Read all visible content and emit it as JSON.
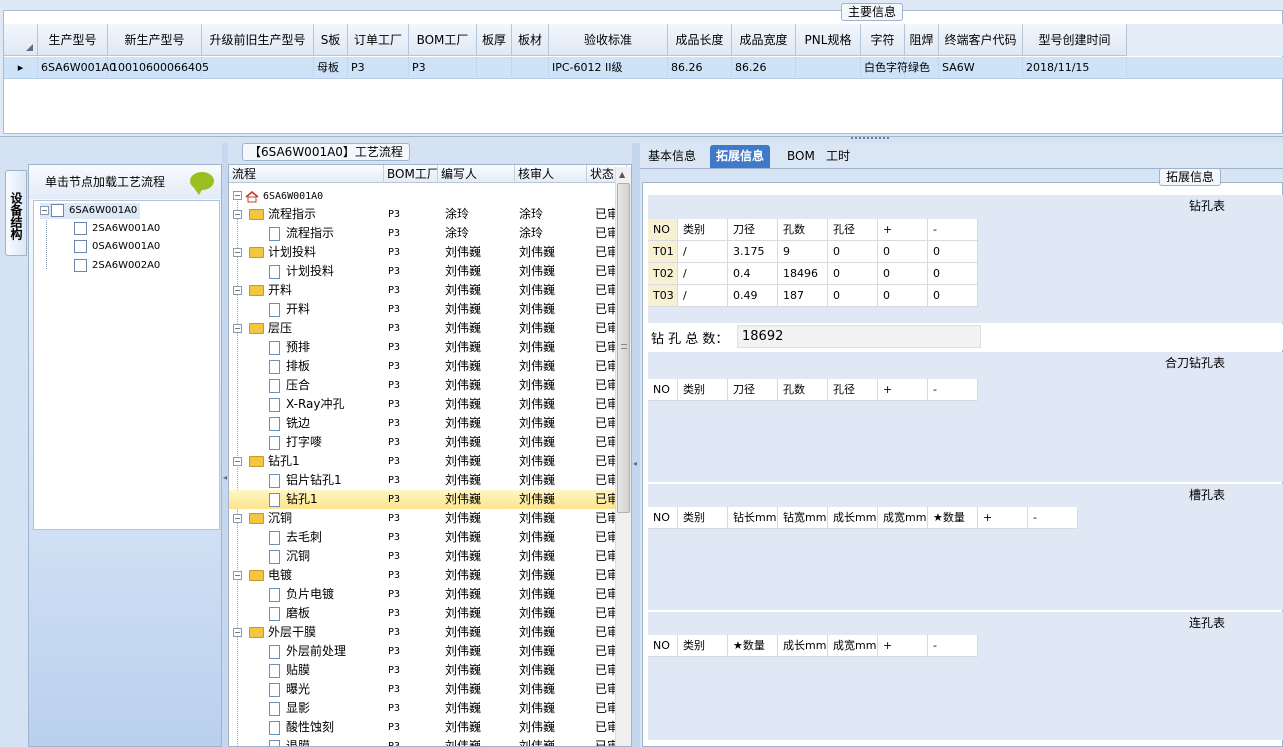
{
  "main_info": {
    "title": "主要信息",
    "columns": [
      "生产型号",
      "新生产型号",
      "升级前旧生产型号",
      "S板",
      "订单工厂",
      "BOM工厂",
      "板厚",
      "板材",
      "验收标准",
      "成品长度",
      "成品宽度",
      "PNL规格",
      "字符",
      "阻焊",
      "终端客户代码",
      "型号创建时间"
    ],
    "row": [
      "6SA6W001A0",
      "10010600066405",
      "",
      "母板",
      "P3",
      "P3",
      "",
      "",
      "IPC-6012 II级",
      "86.26",
      "86.26",
      "",
      "白色字符",
      "绿色",
      "SA6W",
      "2018/11/15"
    ]
  },
  "left_panel": {
    "vertical_tab": "设备结构",
    "header": "单击节点加载工艺流程",
    "root": "6SA6W001A0",
    "children": [
      "2SA6W001A0",
      "0SA6W001A0",
      "2SA6W002A0"
    ]
  },
  "process": {
    "title": "【6SA6W001A0】工艺流程",
    "columns": [
      "流程",
      "BOM工厂",
      "编写人",
      "核审人",
      "状态"
    ],
    "root": "6SA6W001A0",
    "rows": [
      {
        "name": "流程指示",
        "level": 1,
        "factory": "P3",
        "author": "涂玲",
        "reviewer": "涂玲",
        "status": "已审"
      },
      {
        "name": "流程指示",
        "level": 2,
        "factory": "P3",
        "author": "涂玲",
        "reviewer": "涂玲",
        "status": "已审"
      },
      {
        "name": "计划投料",
        "level": 1,
        "factory": "P3",
        "author": "刘伟巍",
        "reviewer": "刘伟巍",
        "status": "已审"
      },
      {
        "name": "计划投料",
        "level": 2,
        "factory": "P3",
        "author": "刘伟巍",
        "reviewer": "刘伟巍",
        "status": "已审"
      },
      {
        "name": "开料",
        "level": 1,
        "factory": "P3",
        "author": "刘伟巍",
        "reviewer": "刘伟巍",
        "status": "已审"
      },
      {
        "name": "开料",
        "level": 2,
        "factory": "P3",
        "author": "刘伟巍",
        "reviewer": "刘伟巍",
        "status": "已审"
      },
      {
        "name": "层压",
        "level": 1,
        "factory": "P3",
        "author": "刘伟巍",
        "reviewer": "刘伟巍",
        "status": "已审"
      },
      {
        "name": "预排",
        "level": 2,
        "factory": "P3",
        "author": "刘伟巍",
        "reviewer": "刘伟巍",
        "status": "已审"
      },
      {
        "name": "排板",
        "level": 2,
        "factory": "P3",
        "author": "刘伟巍",
        "reviewer": "刘伟巍",
        "status": "已审"
      },
      {
        "name": "压合",
        "level": 2,
        "factory": "P3",
        "author": "刘伟巍",
        "reviewer": "刘伟巍",
        "status": "已审"
      },
      {
        "name": "X-Ray冲孔",
        "level": 2,
        "factory": "P3",
        "author": "刘伟巍",
        "reviewer": "刘伟巍",
        "status": "已审"
      },
      {
        "name": "铣边",
        "level": 2,
        "factory": "P3",
        "author": "刘伟巍",
        "reviewer": "刘伟巍",
        "status": "已审"
      },
      {
        "name": "打字嘜",
        "level": 2,
        "factory": "P3",
        "author": "刘伟巍",
        "reviewer": "刘伟巍",
        "status": "已审"
      },
      {
        "name": "钻孔1",
        "level": 1,
        "factory": "P3",
        "author": "刘伟巍",
        "reviewer": "刘伟巍",
        "status": "已审"
      },
      {
        "name": "铝片钻孔1",
        "level": 2,
        "factory": "P3",
        "author": "刘伟巍",
        "reviewer": "刘伟巍",
        "status": "已审"
      },
      {
        "name": "钻孔1",
        "level": 2,
        "factory": "P3",
        "author": "刘伟巍",
        "reviewer": "刘伟巍",
        "status": "已审",
        "selected": true
      },
      {
        "name": "沉铜",
        "level": 1,
        "factory": "P3",
        "author": "刘伟巍",
        "reviewer": "刘伟巍",
        "status": "已审"
      },
      {
        "name": "去毛刺",
        "level": 2,
        "factory": "P3",
        "author": "刘伟巍",
        "reviewer": "刘伟巍",
        "status": "已审"
      },
      {
        "name": "沉铜",
        "level": 2,
        "factory": "P3",
        "author": "刘伟巍",
        "reviewer": "刘伟巍",
        "status": "已审"
      },
      {
        "name": "电镀",
        "level": 1,
        "factory": "P3",
        "author": "刘伟巍",
        "reviewer": "刘伟巍",
        "status": "已审"
      },
      {
        "name": "负片电镀",
        "level": 2,
        "factory": "P3",
        "author": "刘伟巍",
        "reviewer": "刘伟巍",
        "status": "已审"
      },
      {
        "name": "磨板",
        "level": 2,
        "factory": "P3",
        "author": "刘伟巍",
        "reviewer": "刘伟巍",
        "status": "已审"
      },
      {
        "name": "外层干膜",
        "level": 1,
        "factory": "P3",
        "author": "刘伟巍",
        "reviewer": "刘伟巍",
        "status": "已审"
      },
      {
        "name": "外层前处理",
        "level": 2,
        "factory": "P3",
        "author": "刘伟巍",
        "reviewer": "刘伟巍",
        "status": "已审"
      },
      {
        "name": "贴膜",
        "level": 2,
        "factory": "P3",
        "author": "刘伟巍",
        "reviewer": "刘伟巍",
        "status": "已审"
      },
      {
        "name": "曝光",
        "level": 2,
        "factory": "P3",
        "author": "刘伟巍",
        "reviewer": "刘伟巍",
        "status": "已审"
      },
      {
        "name": "显影",
        "level": 2,
        "factory": "P3",
        "author": "刘伟巍",
        "reviewer": "刘伟巍",
        "status": "已审"
      },
      {
        "name": "酸性蚀刻",
        "level": 2,
        "factory": "P3",
        "author": "刘伟巍",
        "reviewer": "刘伟巍",
        "status": "已审"
      },
      {
        "name": "退膜",
        "level": 2,
        "factory": "P3",
        "author": "刘伟巍",
        "reviewer": "刘伟巍",
        "status": "已审"
      }
    ]
  },
  "tabs": [
    "基本信息",
    "拓展信息",
    "BOM",
    "工时"
  ],
  "active_tab": 1,
  "ext": {
    "title": "拓展信息",
    "drill": {
      "title": "钻孔表",
      "columns": [
        "NO",
        "类别",
        "刀径",
        "孔数",
        "孔径",
        "+",
        "-"
      ],
      "rows": [
        [
          "T01",
          "/",
          "3.175",
          "9",
          "0",
          "0",
          "0"
        ],
        [
          "T02",
          "/",
          "0.4",
          "18496",
          "0",
          "0",
          "0"
        ],
        [
          "T03",
          "/",
          "0.49",
          "187",
          "0",
          "0",
          "0"
        ]
      ]
    },
    "total_label": "钻 孔 总 数：",
    "total_value": "18692",
    "combo": {
      "title": "合刀钻孔表",
      "columns": [
        "NO",
        "类别",
        "刀径",
        "孔数",
        "孔径",
        "+",
        "-"
      ]
    },
    "slot": {
      "title": "槽孔表",
      "columns": [
        "NO",
        "类别",
        "钻长mm",
        "钻宽mm",
        "成长mm",
        "成宽mm",
        "★数量",
        "+",
        "-"
      ]
    },
    "link": {
      "title": "连孔表",
      "columns": [
        "NO",
        "类别",
        "★数量",
        "成长mm",
        "成宽mm",
        "+",
        "-"
      ]
    }
  },
  "colors": {
    "accent": "#3f79c9",
    "selected_row": "#fde48c",
    "header_bg": "#dfe8f4"
  }
}
